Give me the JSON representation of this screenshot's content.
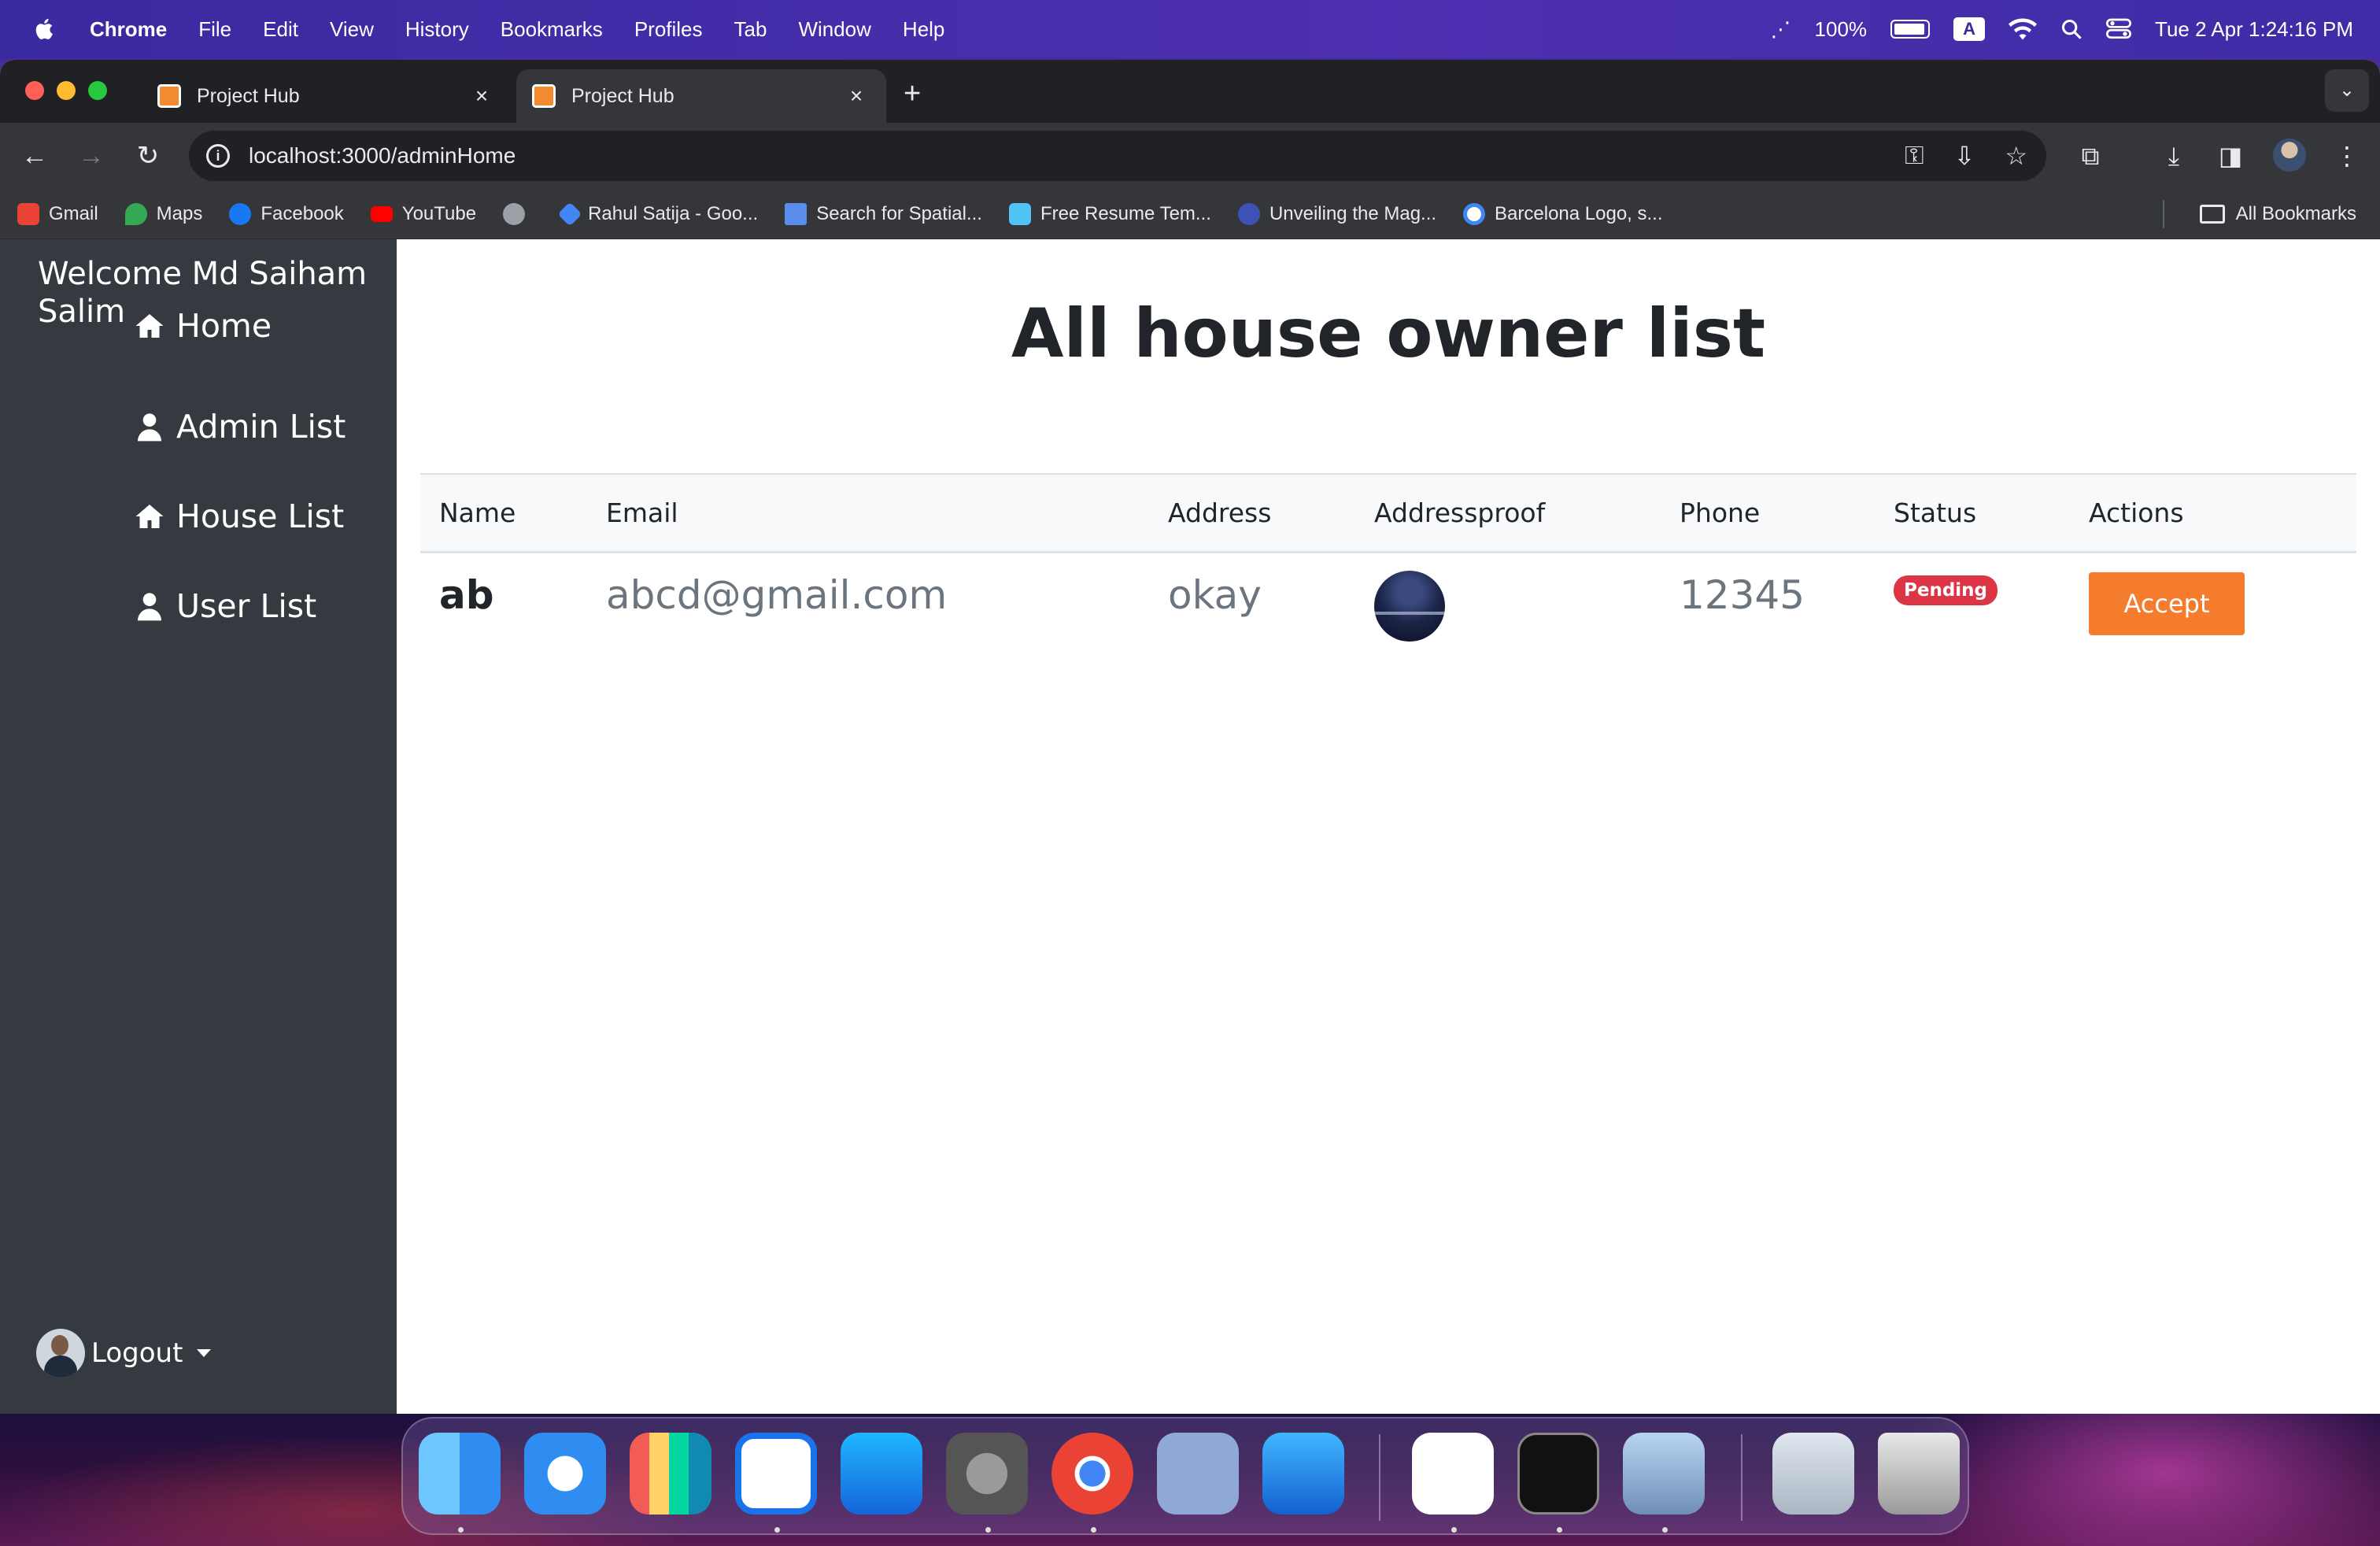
{
  "menubar": {
    "app": "Chrome",
    "items": [
      "File",
      "Edit",
      "View",
      "History",
      "Bookmarks",
      "Profiles",
      "Tab",
      "Window",
      "Help"
    ],
    "battery": "100%",
    "input_source": "A",
    "datetime": "Tue 2 Apr  1:24:16 PM"
  },
  "browser": {
    "tabs": [
      {
        "title": "Project Hub",
        "active": false
      },
      {
        "title": "Project Hub",
        "active": true
      }
    ],
    "new_tab": "+",
    "close_glyph": "×",
    "url": "localhost:3000/adminHome",
    "bookmarks": [
      {
        "label": "Gmail",
        "icon": "gmail-icon",
        "color": "#ea4335"
      },
      {
        "label": "Maps",
        "icon": "maps-icon",
        "color": "#34a853"
      },
      {
        "label": "Facebook",
        "icon": "facebook-icon",
        "color": "#1877f2"
      },
      {
        "label": "YouTube",
        "icon": "youtube-icon",
        "color": "#ff0000"
      },
      {
        "label": "",
        "icon": "globe-icon",
        "color": "#9aa0a6"
      },
      {
        "label": "Rahul Satija - Goo...",
        "icon": "scholar-icon",
        "color": "#4285f4"
      },
      {
        "label": "Search for Spatial...",
        "icon": "spatial-icon",
        "color": "#5b8def"
      },
      {
        "label": "Free Resume Tem...",
        "icon": "resume-icon",
        "color": "#4fc3f7"
      },
      {
        "label": "Unveiling the Mag...",
        "icon": "article-icon",
        "color": "#3f51b5"
      },
      {
        "label": "Barcelona Logo, s...",
        "icon": "google-icon",
        "color": "#ffffff"
      }
    ],
    "all_bookmarks": "All Bookmarks"
  },
  "sidebar": {
    "welcome": "Welcome Md Saiham Salim",
    "nav": [
      {
        "label": "Home",
        "icon": "home-icon"
      },
      {
        "label": "Admin List",
        "icon": "user-icon"
      },
      {
        "label": "House List",
        "icon": "home-icon"
      },
      {
        "label": "User List",
        "icon": "user-icon"
      }
    ],
    "logout": "Logout"
  },
  "main": {
    "title": "All house owner list",
    "columns": [
      "Name",
      "Email",
      "Address",
      "Addressproof",
      "Phone",
      "Status",
      "Actions"
    ],
    "rows": [
      {
        "name": "ab",
        "email": "abcd@gmail.com",
        "address": "okay",
        "phone": "12345",
        "status": "Pending",
        "action": "Accept"
      }
    ]
  },
  "colors": {
    "sidebar_bg": "#343a40",
    "accent_button": "#f47c2c",
    "status_pending": "#dc3545"
  },
  "dock": [
    "finder-icon",
    "safari-icon",
    "launchpad-icon",
    "vscode-icon",
    "appstore-icon",
    "settings-icon",
    "chrome-icon",
    "r-icon",
    "xcode-icon",
    "mongodb-icon",
    "terminal-icon",
    "preview-icon",
    "photo-icon",
    "trash-icon"
  ]
}
